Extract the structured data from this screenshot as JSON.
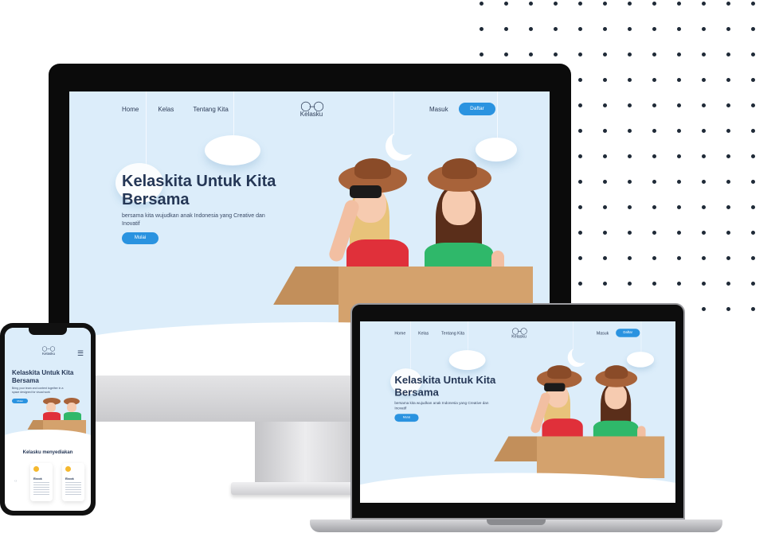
{
  "desktop_site": {
    "nav": [
      "Home",
      "Kelas",
      "Tentang Kita"
    ],
    "logo_text": "Kelasku",
    "masuk": "Masuk",
    "daftar": "Daftar",
    "hero_title": "Kelaskita Untuk Kita Bersama",
    "hero_sub": "bersama kita wujudkan anak Indonesia yang Creative dan Inovatif",
    "mulai": "Mulai"
  },
  "laptop_site": {
    "nav": [
      "Home",
      "Kelas",
      "Tentang Kita"
    ],
    "logo_text": "Kelasku",
    "masuk": "Masuk",
    "daftar": "Daftar",
    "hero_title": "Kelaskita Untuk Kita Bersama",
    "hero_sub": "bersama kita wujudkan anak Indonesia yang Creative dan Inovatif",
    "mulai": "Mulai"
  },
  "phone_site": {
    "logo_text": "Kelasku",
    "hero_title": "Kelaskita Untuk Kita Bersama",
    "hero_sub": "Bring your team and content together in a space designed for visual work",
    "mulai": "Mulai",
    "section_title": "Kelasku menyediakan",
    "cards": [
      "Ebook",
      "Ebook"
    ]
  },
  "colors": {
    "accent": "#2a93e0",
    "hero_bg": "#dcedfa",
    "heading": "#253756"
  }
}
